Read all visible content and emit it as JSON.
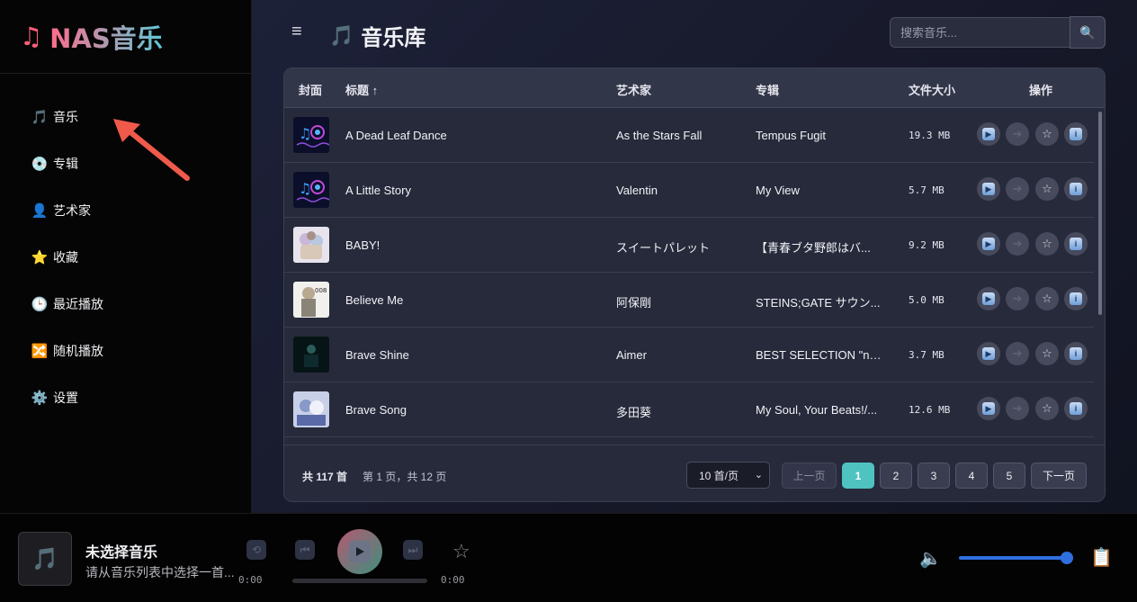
{
  "app": {
    "logo_icon": "music-note-icon",
    "logo_text": "NAS音乐"
  },
  "sidebar": {
    "items": [
      {
        "icon": "🎵",
        "label": "音乐"
      },
      {
        "icon": "💿",
        "label": "专辑"
      },
      {
        "icon": "👤",
        "label": "艺术家"
      },
      {
        "icon": "⭐",
        "label": "收藏"
      },
      {
        "icon": "🕒",
        "label": "最近播放"
      },
      {
        "icon": "🔀",
        "label": "随机播放"
      },
      {
        "icon": "⚙️",
        "label": "设置"
      }
    ]
  },
  "header": {
    "menu_icon": "≡",
    "title_icon": "🎵",
    "title": "音乐库",
    "search_placeholder": "搜索音乐...",
    "search_icon": "🔍"
  },
  "table": {
    "columns": {
      "cover": "封面",
      "title": "标题 ↑",
      "artist": "艺术家",
      "album": "专辑",
      "size": "文件大小",
      "actions": "操作"
    },
    "rows": [
      {
        "title": "A Dead Leaf Dance",
        "artist": "As the Stars Fall",
        "album": "Tempus Fugit",
        "size": "19.3 MB"
      },
      {
        "title": "A Little Story",
        "artist": "Valentin",
        "album": "My View",
        "size": "5.7 MB"
      },
      {
        "title": "BABY!",
        "artist": "スイートパレット",
        "album": "【青春ブタ野郎はバ...",
        "size": "9.2 MB"
      },
      {
        "title": "Believe Me",
        "artist": "阿保剛",
        "album": "STEINS;GATE サウン...",
        "size": "5.0 MB"
      },
      {
        "title": "Brave Shine",
        "artist": "Aimer",
        "album": "BEST SELECTION \"noir\"",
        "size": "3.7 MB"
      },
      {
        "title": "Brave Song",
        "artist": "多田葵",
        "album": "My Soul, Your Beats!/...",
        "size": "12.6 MB"
      }
    ],
    "action_icons": [
      "play-icon",
      "next-icon",
      "star-icon",
      "info-icon"
    ]
  },
  "pagination": {
    "total": "共 117 首",
    "page_info": "第 1 页，共 12 页",
    "per_page": "10 首/页",
    "prev": "上一页",
    "pages": [
      "1",
      "2",
      "3",
      "4",
      "5"
    ],
    "current": "1",
    "next": "下一页"
  },
  "player": {
    "cover_icon": "🎵",
    "title": "未选择音乐",
    "subtitle": "请从音乐列表中选择一首...",
    "current_time": "0:00",
    "duration": "0:00",
    "volume": 1.0,
    "colors": {
      "accent": "#4fc3c0",
      "volume": "#2f6fe0"
    }
  }
}
